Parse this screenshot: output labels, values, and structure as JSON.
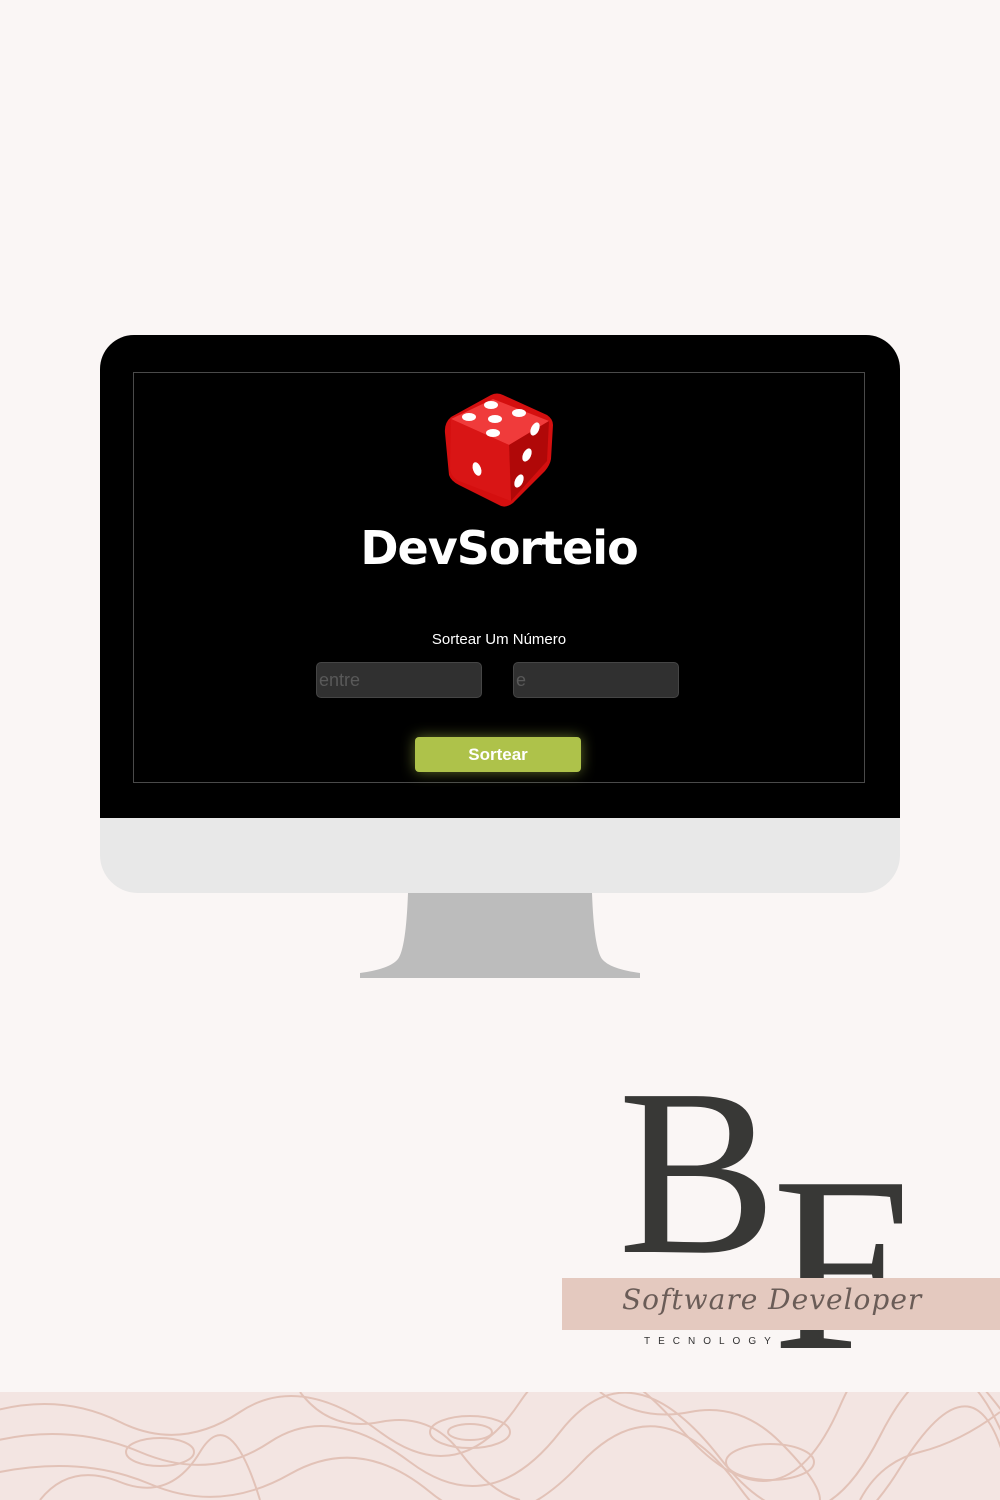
{
  "app": {
    "title": "DevSorteio",
    "section_label": "Sortear Um Número",
    "input_from_placeholder": "entre",
    "input_to_placeholder": "e",
    "draw_button_label": "Sortear",
    "accent_color": "#aec24a",
    "dice_color": "#d40f0f"
  },
  "branding": {
    "logo_letters": "BF",
    "script_line": "Software Developer",
    "tagline": "TECNOLOGY"
  }
}
